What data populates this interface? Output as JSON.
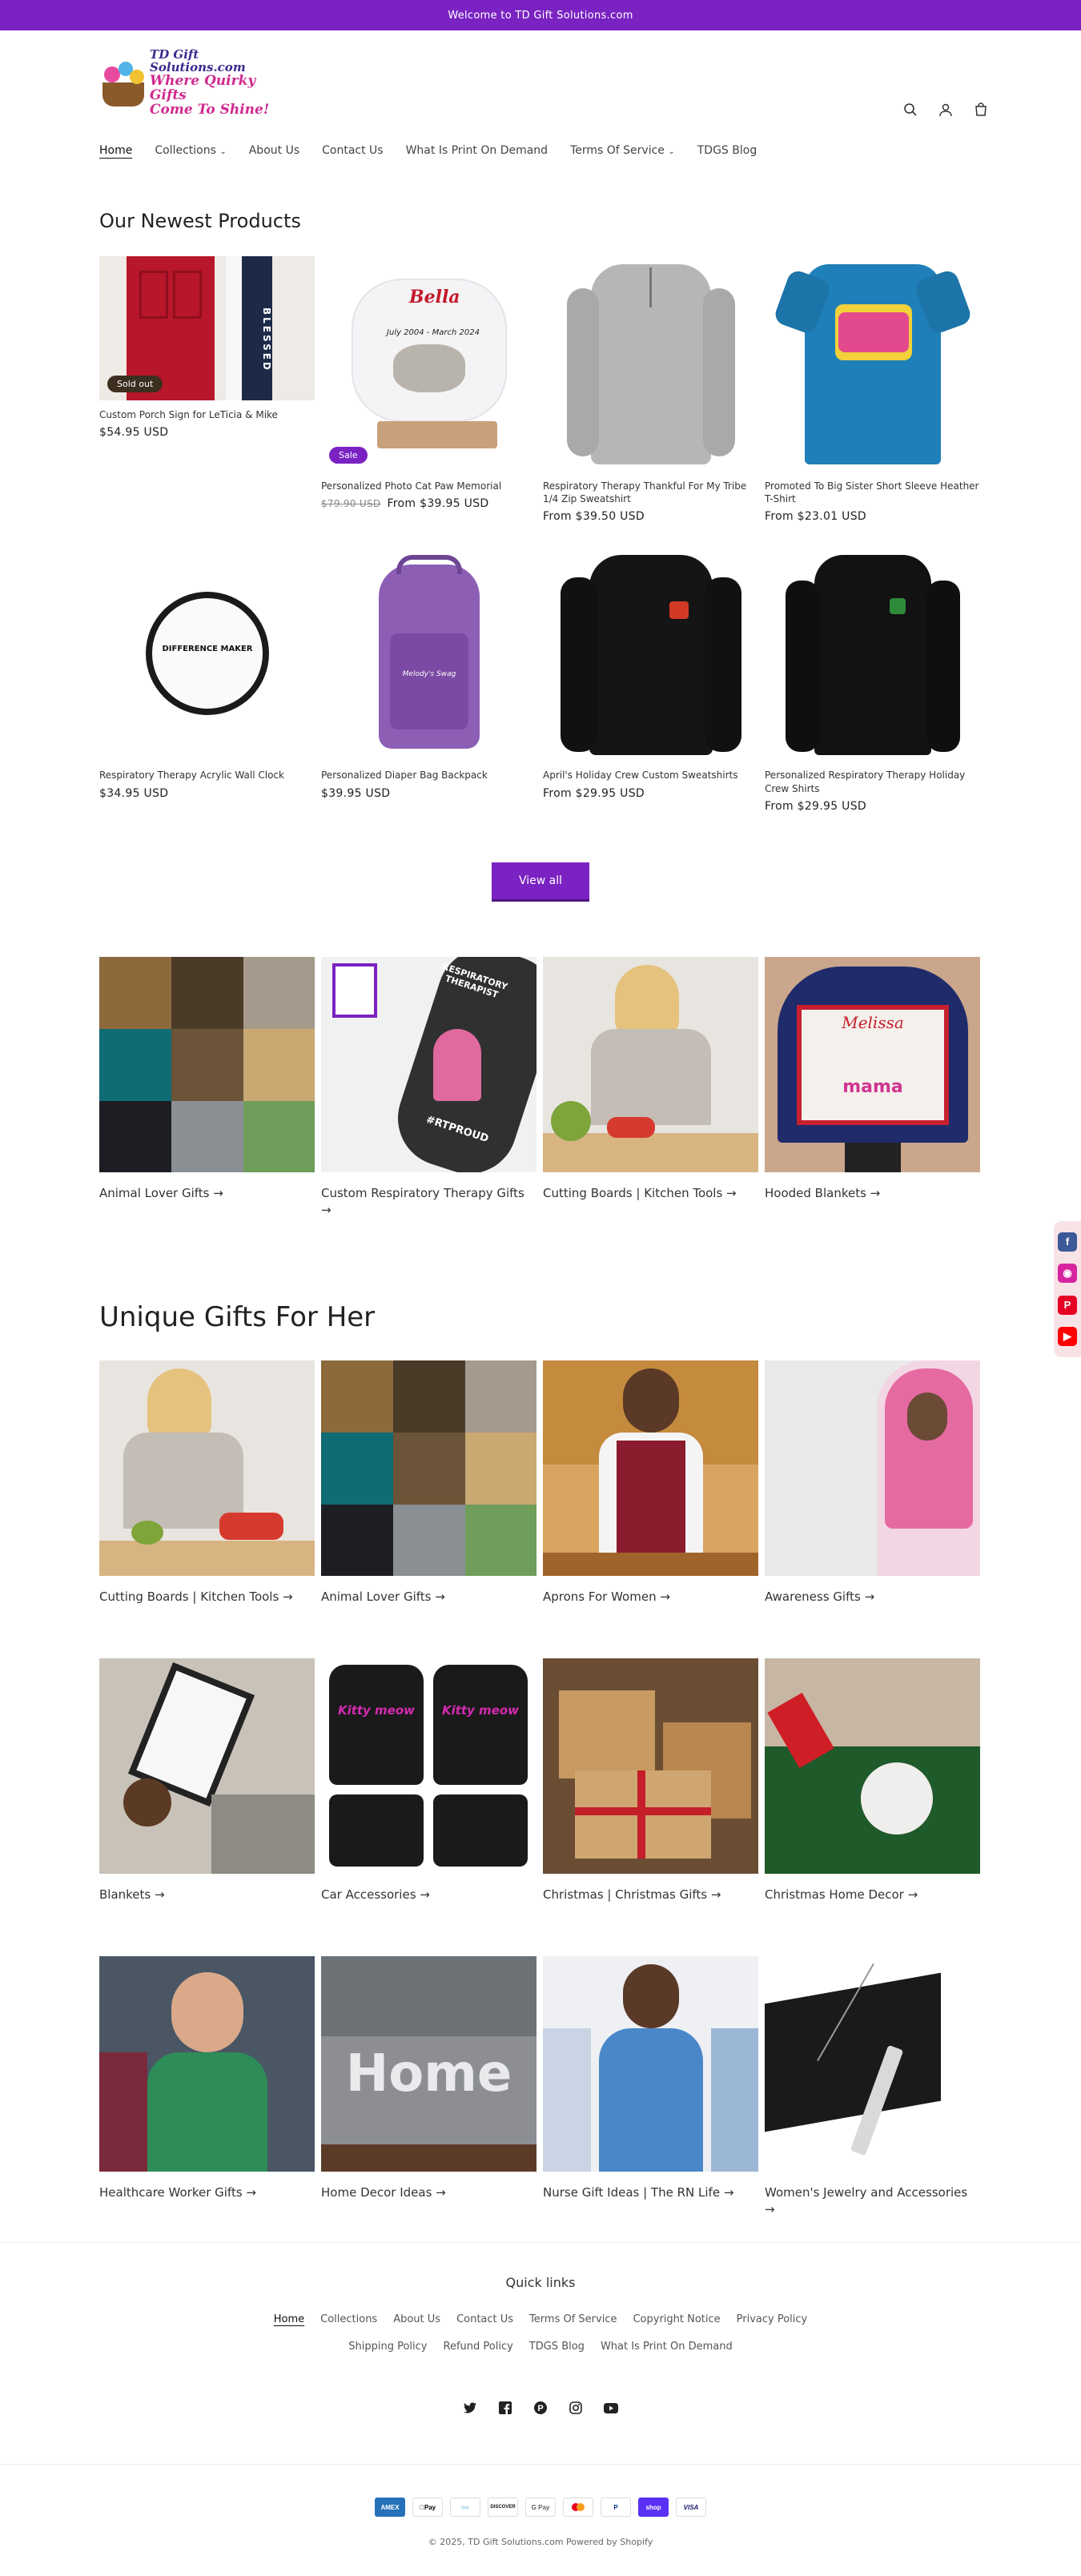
{
  "announcement": "Welcome to TD Gift Solutions.com",
  "brand": {
    "logo_line1": "TD Gift Solutions.com",
    "logo_line2": "Where Quirky Gifts",
    "logo_line3": "Come To Shine!",
    "accent_color": "#7a22c2"
  },
  "header_icons": [
    "search-icon",
    "account-icon",
    "cart-icon"
  ],
  "nav": [
    "Home",
    "Collections",
    "About Us",
    "Contact Us",
    "What Is Print On Demand",
    "Terms Of Service",
    "TDGS Blog"
  ],
  "products_section": {
    "title": "Our Newest Products",
    "items": [
      {
        "title": "Custom Porch Sign for LeTicia & Mike",
        "price": "$54.95 USD",
        "badge": "Sold out",
        "compare_price": ""
      },
      {
        "title": "Personalized Photo Cat Paw Memorial",
        "price": "$39.95 USD",
        "badge": "Sale",
        "compare_price": "$79.90 USD",
        "price_prefix": "From"
      },
      {
        "title": "Respiratory Therapy Thankful For My Tribe 1/4 Zip Sweatshirt",
        "price": "From $39.50 USD",
        "badge": "",
        "compare_price": ""
      },
      {
        "title": "Promoted To Big Sister Short Sleeve Heather T-Shirt",
        "price": "From $23.01 USD",
        "badge": "",
        "compare_price": ""
      },
      {
        "title": "Respiratory Therapy Acrylic Wall Clock",
        "price": "$34.95 USD",
        "badge": "",
        "compare_price": ""
      },
      {
        "title": "Personalized Diaper Bag Backpack",
        "price": "$39.95 USD",
        "badge": "",
        "compare_price": ""
      },
      {
        "title": "April's Holiday Crew Custom Sweatshirts",
        "price": "From $29.95 USD",
        "badge": "",
        "compare_price": ""
      },
      {
        "title": "Personalized Respiratory Therapy Holiday Crew Shirts",
        "price": "From $29.95 USD",
        "badge": "",
        "compare_price": ""
      }
    ],
    "view_all": "View all"
  },
  "image_text": {
    "clock_center": "DIFFERENCE MAKER",
    "diaper_bag": "Melody's Swag",
    "rt_tumbler": "RESPIRATORY THERAPIST",
    "rt_hashtag": "#RTPROUD",
    "blanket_name": "Melissa",
    "blanket_word": "mama",
    "porch_sign": "BLESSED",
    "cat_memorial_name": "Bella",
    "cat_memorial_dates": "July 2004 - March 2024",
    "home_letters": "Home",
    "kitty_mat": "Kitty meow"
  },
  "featured_collections": [
    {
      "label": "Animal Lover Gifts →"
    },
    {
      "label": "Custom Respiratory Therapy Gifts →"
    },
    {
      "label": "Cutting Boards | Kitchen Tools →"
    },
    {
      "label": "Hooded Blankets →"
    }
  ],
  "gifts_for_her": {
    "title": "Unique Gifts For Her",
    "items": [
      {
        "label": "Cutting Boards | Kitchen Tools →"
      },
      {
        "label": "Animal Lover Gifts →"
      },
      {
        "label": "Aprons For Women →"
      },
      {
        "label": "Awareness Gifts →"
      },
      {
        "label": "Blankets →"
      },
      {
        "label": "Car Accessories →"
      },
      {
        "label": "Christmas | Christmas Gifts →"
      },
      {
        "label": "Christmas Home Decor →"
      },
      {
        "label": "Healthcare Worker Gifts →"
      },
      {
        "label": "Home Decor Ideas →"
      },
      {
        "label": "Nurse Gift Ideas | The RN Life →"
      },
      {
        "label": "Women's Jewelry and Accessories →"
      }
    ]
  },
  "floating_social": [
    "facebook-icon",
    "instagram-icon",
    "pinterest-icon",
    "youtube-icon"
  ],
  "footer": {
    "heading": "Quick links",
    "links_row1": [
      "Home",
      "Collections",
      "About Us",
      "Contact Us",
      "Terms Of Service",
      "Copyright Notice",
      "Privacy Policy"
    ],
    "links_row2": [
      "Shipping Policy",
      "Refund Policy",
      "TDGS Blog",
      "What Is Print On Demand"
    ],
    "social_icons": [
      "twitter-icon",
      "facebook-icon",
      "pinterest-icon",
      "instagram-icon",
      "youtube-icon"
    ],
    "payments": [
      "American Express",
      "Apple Pay",
      "Diners Club",
      "Discover",
      "Google Pay",
      "Mastercard",
      "PayPal",
      "Shop Pay",
      "Visa"
    ],
    "copyright": "© 2025, TD Gift Solutions.com Powered by Shopify"
  }
}
